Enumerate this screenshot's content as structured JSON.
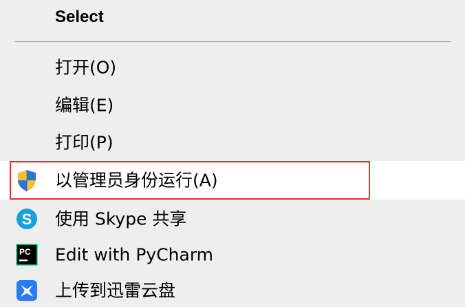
{
  "menu": {
    "header": "Select",
    "items": [
      {
        "label": "打开(O)"
      },
      {
        "label": "编辑(E)"
      },
      {
        "label": "打印(P)"
      },
      {
        "label": "以管理员身份运行(A)",
        "icon": "uac-shield-icon",
        "highlighted": true
      },
      {
        "label": "使用 Skype 共享",
        "icon": "skype-icon"
      },
      {
        "label": "Edit with PyCharm",
        "icon": "pycharm-icon"
      },
      {
        "label": "上传到迅雷云盘",
        "icon": "xunlei-icon"
      }
    ]
  },
  "colors": {
    "menu_background": "#eeeeee",
    "hover_background": "#ffffff",
    "highlight_border": "#e0302f",
    "skype_blue": "#1aa1dd",
    "xunlei_blue": "#2b7cf0"
  }
}
